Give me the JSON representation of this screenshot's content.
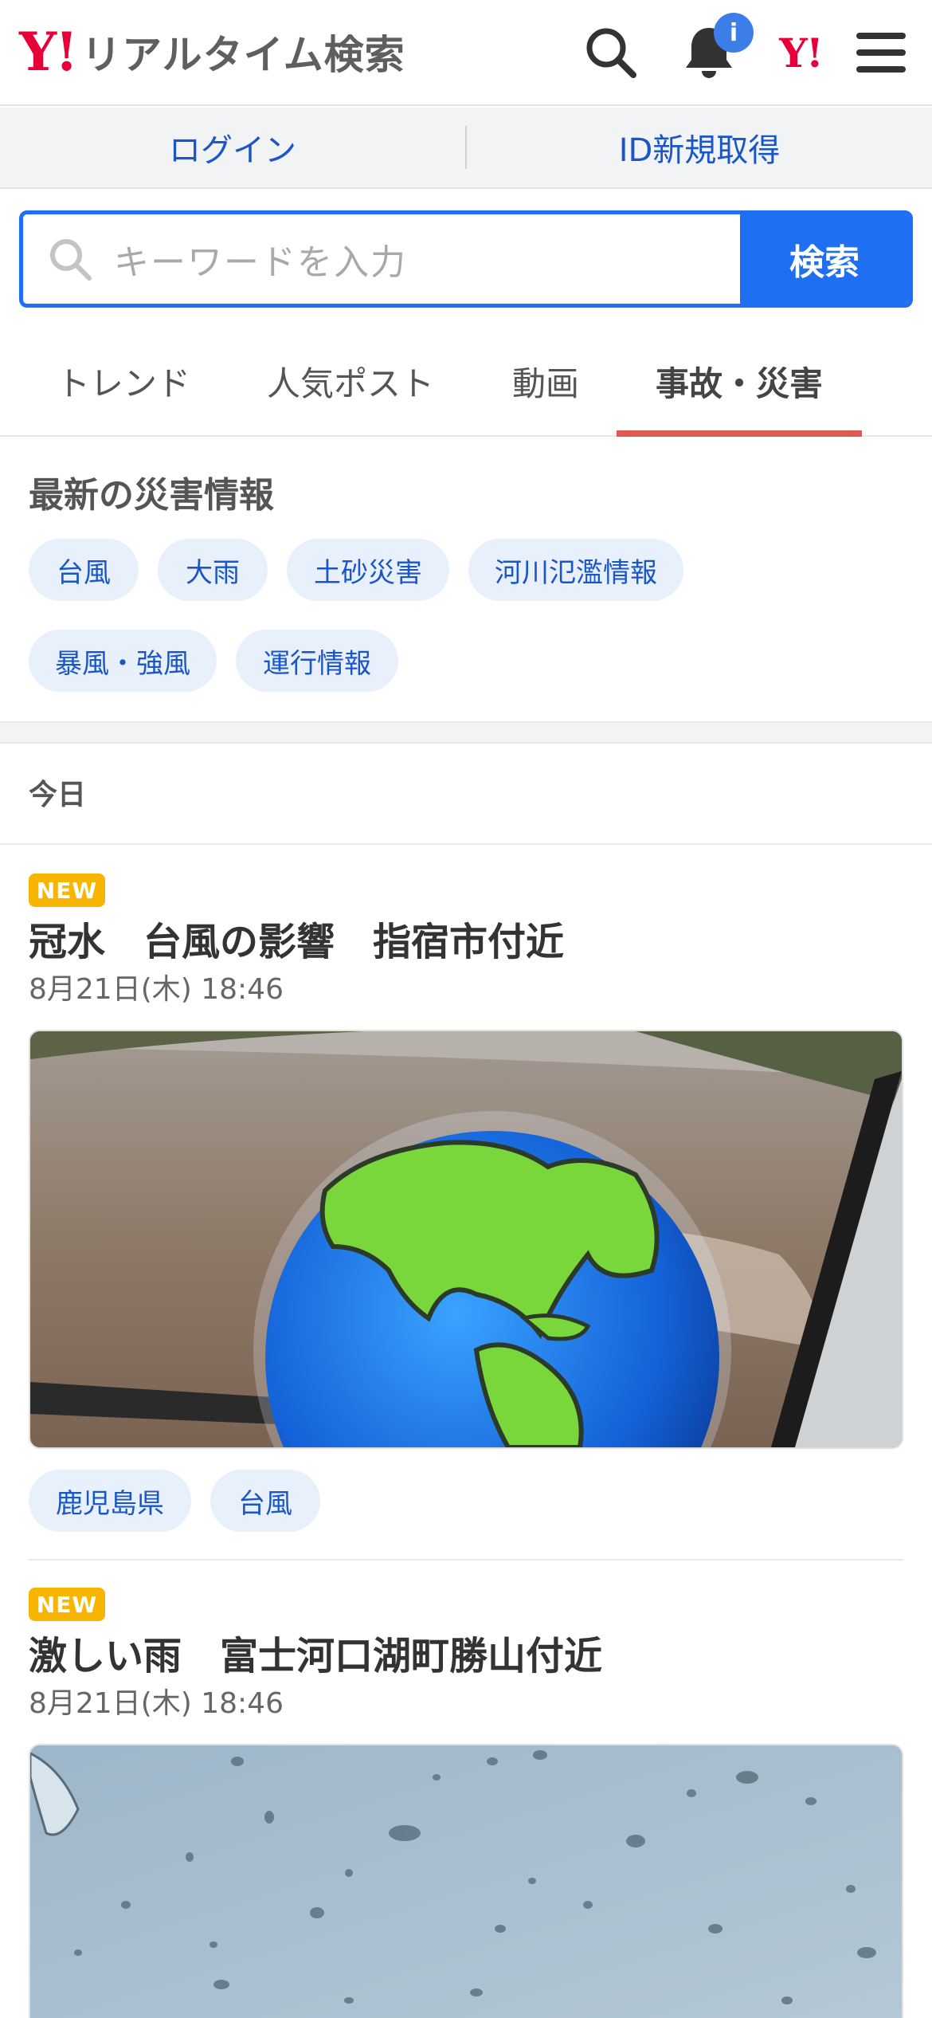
{
  "header": {
    "logo_mark": "Y!",
    "logo_text": "リアルタイム検索",
    "notification_badge": "i",
    "yahoo_mini_logo": "Y!",
    "icons": [
      "search-icon",
      "bell-icon",
      "yahoo-logo-icon",
      "menu-icon"
    ]
  },
  "login_bar": {
    "login": "ログイン",
    "register": "ID新規取得"
  },
  "search": {
    "placeholder": "キーワードを入力",
    "button": "検索"
  },
  "tabs": [
    {
      "label": "トレンド",
      "active": false
    },
    {
      "label": "人気ポスト",
      "active": false
    },
    {
      "label": "動画",
      "active": false
    },
    {
      "label": "事故・災害",
      "active": true
    }
  ],
  "disaster_info": {
    "title": "最新の災害情報",
    "chips": [
      "台風",
      "大雨",
      "土砂災害",
      "河川氾濫情報",
      "暴風・強風",
      "運行情報"
    ]
  },
  "timeline": {
    "day_label": "今日",
    "posts": [
      {
        "badge": "NEW",
        "title": "冠水　台風の影響　指宿市付近",
        "time": "8月21日(木) 18:46",
        "tags": [
          "鹿児島県",
          "台風"
        ]
      },
      {
        "badge": "NEW",
        "title": "激しい雨　富士河口湖町勝山付近",
        "time": "8月21日(木) 18:46",
        "tags": []
      }
    ]
  },
  "colors": {
    "brand_red": "#e60039",
    "link_blue": "#1a56c8",
    "search_blue": "#1f6ff2",
    "tab_underline": "#e15a52",
    "new_badge": "#f7b500",
    "chip_bg": "#e8f0fb"
  }
}
